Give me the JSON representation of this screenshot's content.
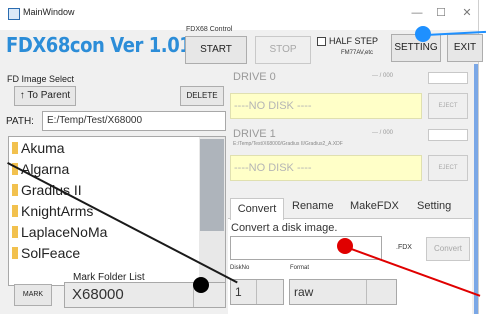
{
  "window": {
    "title": "MainWindow",
    "minimize": "—",
    "maximize": "☐",
    "close": "✕"
  },
  "app": {
    "logo": "FDX68con Ver 1.01",
    "control_group_label": "FDX68 Control"
  },
  "control": {
    "start": "START",
    "stop": "STOP",
    "half_step_label": "HALF STEP",
    "half_step_sub": "FM77AV,etc",
    "half_step_checked": false,
    "setting": "SETTING",
    "exit": "EXIT"
  },
  "fd_image": {
    "section_label": "FD Image Select",
    "to_parent": "↑ To Parent",
    "delete": "DELETE",
    "path_label": "PATH:",
    "path_value": "E:/Temp/Test/X68000",
    "folders": [
      "Akuma",
      "Algarna",
      "Gradius II",
      "KnightArms",
      "LaplaceNoMa",
      "SolFeace"
    ],
    "mark_folder_list_label": "Mark Folder List",
    "mark_button": "MARK",
    "mark_selected": "X68000"
  },
  "drives": [
    {
      "title": "DRIVE 0",
      "path": "",
      "counter": "---  /  000",
      "status": "----NO DISK ----",
      "eject": "EJECT"
    },
    {
      "title": "DRIVE 1",
      "path": "E:/Temp/Test/X68000/Gradius II/Gradius2_A.XDF",
      "counter": "---  /  000",
      "status": "----NO DISK ----",
      "eject": "EJECT"
    }
  ],
  "tabs": [
    {
      "label": "Convert"
    },
    {
      "label": "Rename"
    },
    {
      "label": "MakeFDX"
    },
    {
      "label": "Setting"
    }
  ],
  "convert": {
    "description": "Convert a disk image.",
    "input_value": "",
    "ext_label": ".FDX",
    "convert_button": "Convert",
    "diskno_label": "DiskNo",
    "diskno_value": "1",
    "format_label": "Format",
    "format_value": "raw"
  },
  "colors": {
    "logo": "#2c8dd8",
    "no_disk_bg": "#ffffc8",
    "annotation_blue": "#1e90ff",
    "annotation_red": "#e00000",
    "annotation_black": "#000000"
  }
}
